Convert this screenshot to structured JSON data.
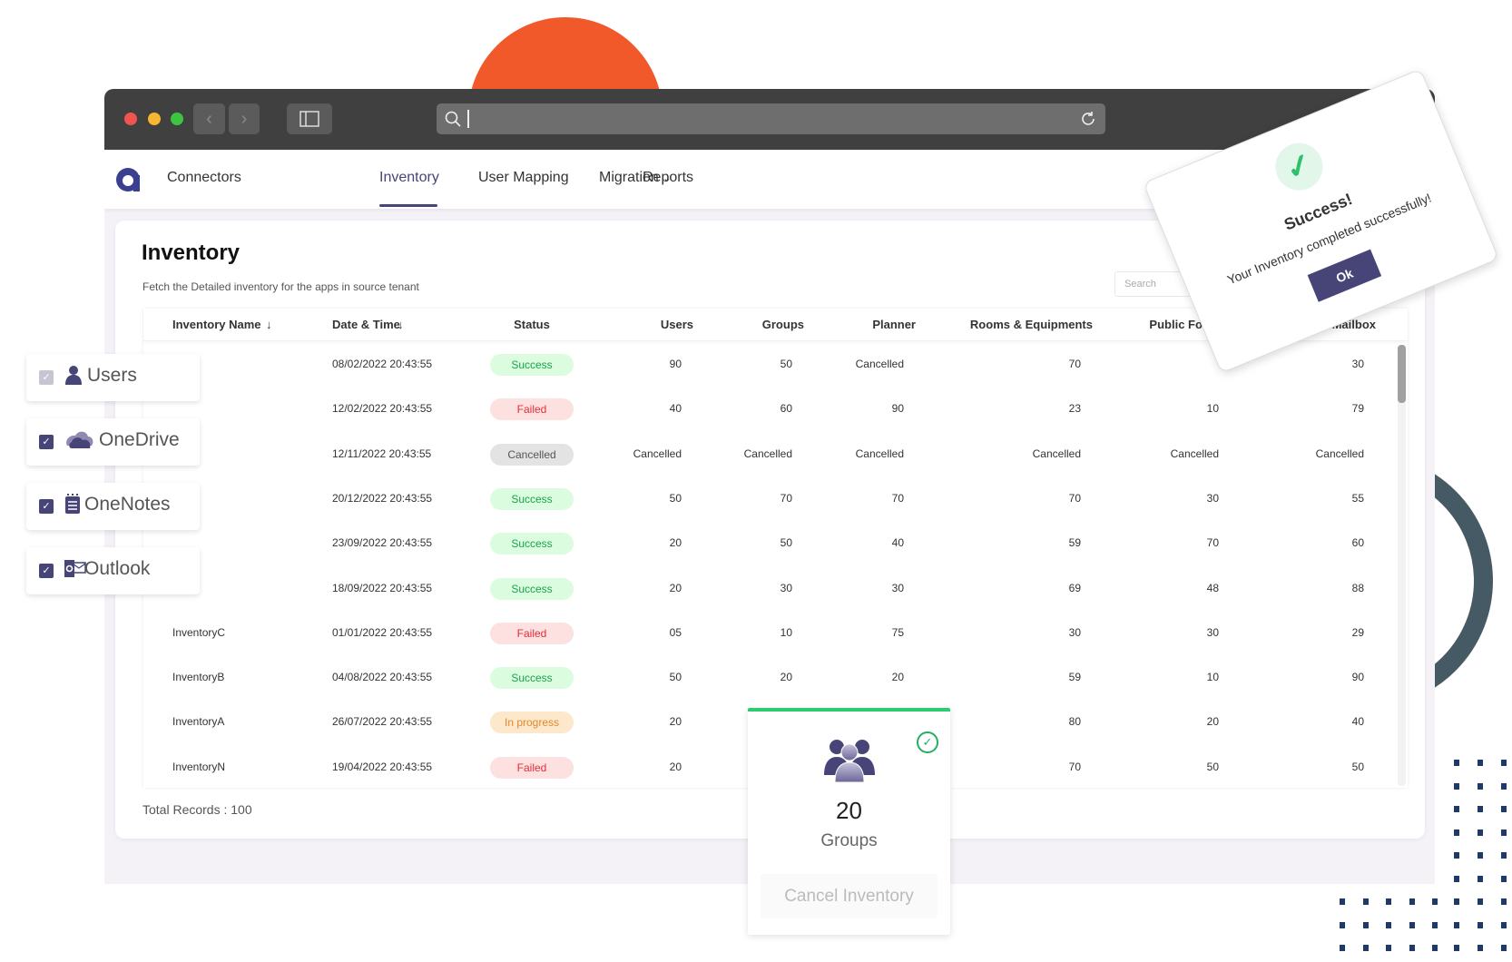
{
  "colors": {
    "accent": "#474478",
    "success": "#1aa34a",
    "failed": "#e0303a",
    "in_progress": "#e0892b",
    "progress_bar": "#2ecc71",
    "decor_orange": "#f2592a",
    "decor_arc": "#455a64",
    "decor_dots": "#1f3a68"
  },
  "browser": {
    "url_value": "",
    "icons": [
      "back-icon",
      "forward-icon",
      "sidebar-icon",
      "search-icon",
      "reload-icon"
    ]
  },
  "nav": {
    "items": [
      {
        "label": "Connectors"
      },
      {
        "label": "Inventory",
        "active": true
      },
      {
        "label": "User Mapping"
      },
      {
        "label": "Migration"
      },
      {
        "label": "Reports"
      }
    ]
  },
  "page": {
    "title": "Inventory",
    "subtitle": "Fetch the Detailed inventory for the apps in source tenant",
    "search_placeholder": "Search",
    "total_records": "Total Records : 100"
  },
  "table": {
    "columns": [
      "Inventory Name",
      "Date & Time",
      "Status",
      "Users",
      "Groups",
      "Planner",
      "Rooms & Equipments",
      "Public Folders",
      "Mailbox"
    ],
    "rows": [
      [
        "",
        "08/02/2022 20:43:55",
        "Success",
        "90",
        "50",
        "Cancelled",
        "70",
        "",
        "30"
      ],
      [
        "",
        "12/02/2022 20:43:55",
        "Failed",
        "40",
        "60",
        "90",
        "23",
        "10",
        "79"
      ],
      [
        "",
        "12/11/2022 20:43:55",
        "Cancelled",
        "Cancelled",
        "Cancelled",
        "Cancelled",
        "Cancelled",
        "Cancelled",
        "Cancelled"
      ],
      [
        "",
        "20/12/2022 20:43:55",
        "Success",
        "50",
        "70",
        "70",
        "70",
        "30",
        "55"
      ],
      [
        "",
        "23/09/2022 20:43:55",
        "Success",
        "20",
        "50",
        "40",
        "59",
        "70",
        "60"
      ],
      [
        "",
        "18/09/2022 20:43:55",
        "Success",
        "20",
        "30",
        "30",
        "69",
        "48",
        "88"
      ],
      [
        "InventoryC",
        "01/01/2022 20:43:55",
        "Failed",
        "05",
        "10",
        "75",
        "30",
        "30",
        "29"
      ],
      [
        "InventoryB",
        "04/08/2022 20:43:55",
        "Success",
        "50",
        "20",
        "20",
        "59",
        "10",
        "90"
      ],
      [
        "InventoryA",
        "26/07/2022 20:43:55",
        "In progress",
        "20",
        "",
        "",
        "80",
        "20",
        "40"
      ],
      [
        "InventoryN",
        "19/04/2022 20:43:55",
        "Failed",
        "20",
        "",
        "",
        "70",
        "50",
        "50"
      ]
    ]
  },
  "apps": [
    {
      "label": "Users",
      "icon": "user-icon",
      "checked": true,
      "disabled": true
    },
    {
      "label": "OneDrive",
      "icon": "onedrive-cloud-icon",
      "checked": true
    },
    {
      "label": "OneNotes",
      "icon": "onenote-notebook-icon",
      "checked": true
    },
    {
      "label": "Outlook",
      "icon": "outlook-icon",
      "checked": true
    }
  ],
  "group_card": {
    "count": "20",
    "label": "Groups",
    "cancel_label": "Cancel Inventory"
  },
  "popup": {
    "title": "Success!",
    "message": "Your Inventory completed successfully!",
    "ok_label": "Ok"
  }
}
